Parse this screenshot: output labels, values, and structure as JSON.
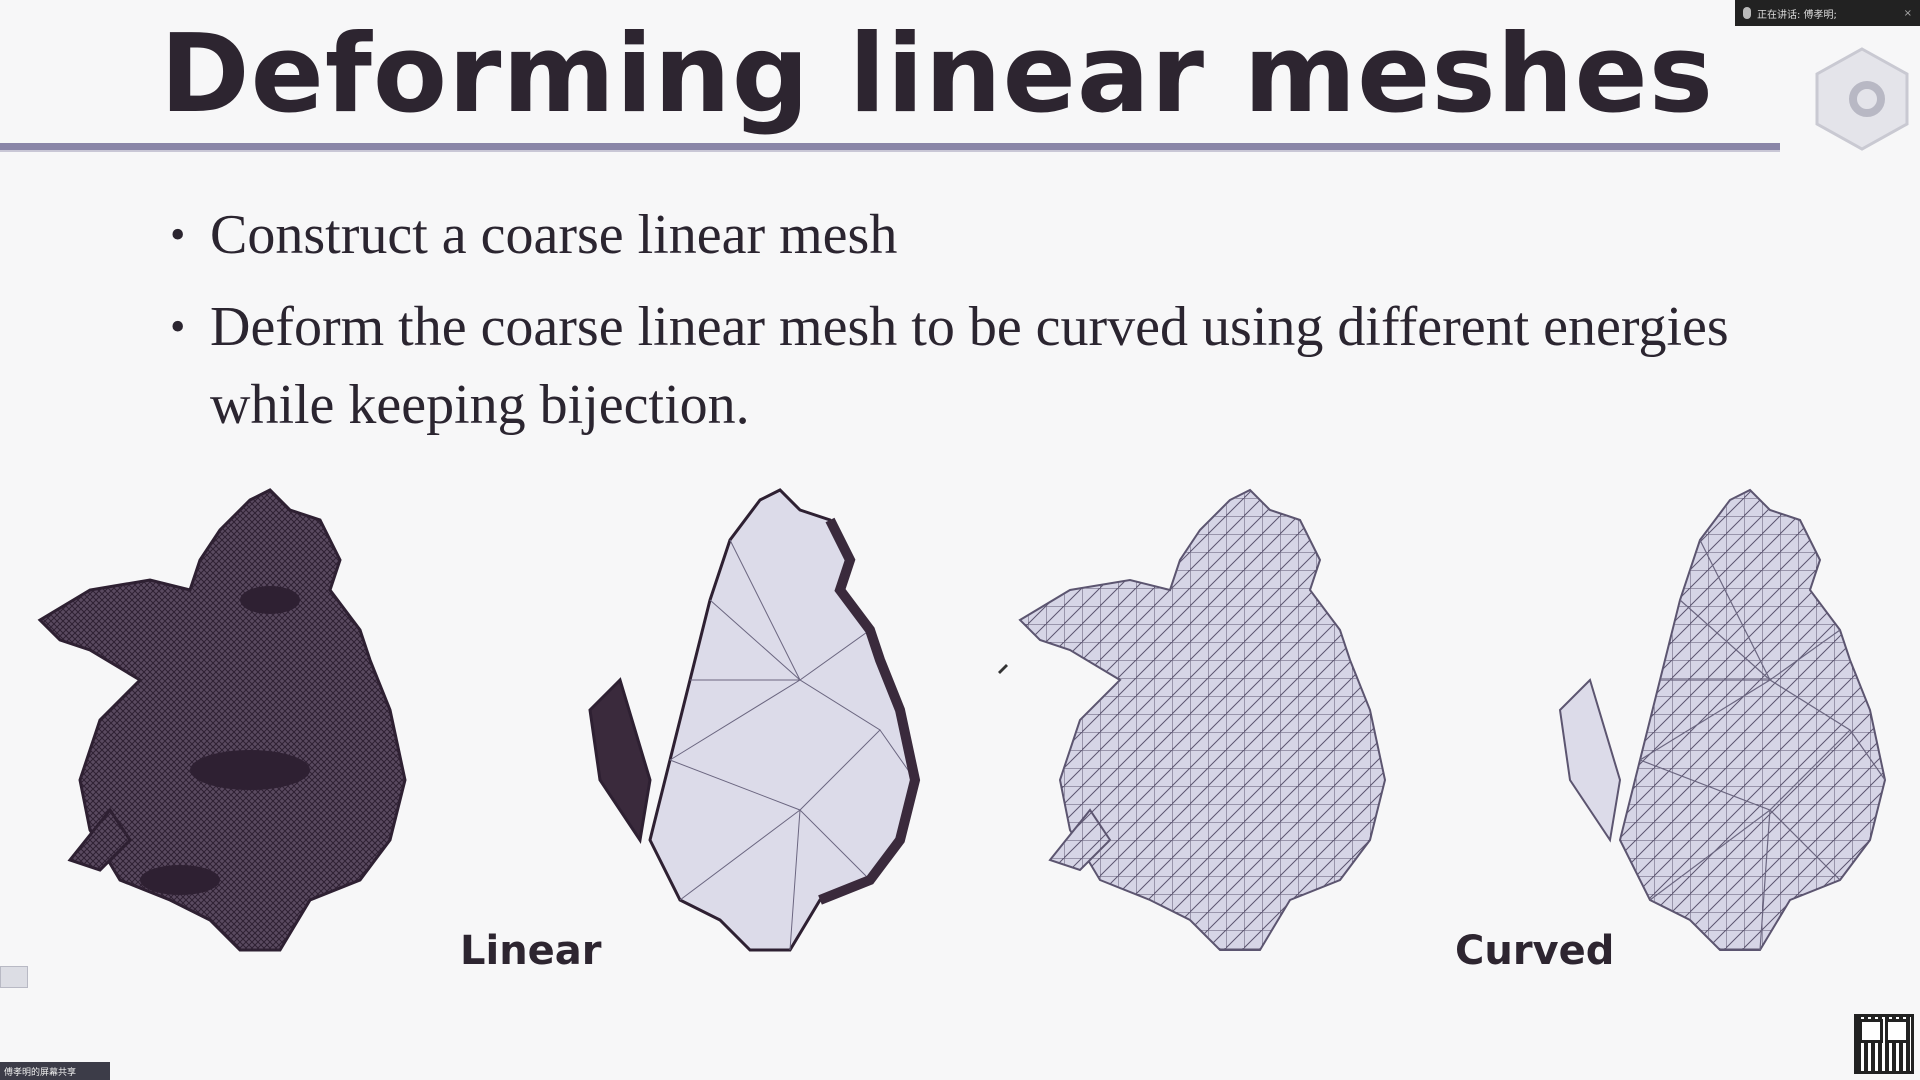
{
  "slide": {
    "title": "Deforming linear meshes",
    "bullets": [
      "Construct a coarse linear mesh",
      "Deform the coarse linear mesh to be curved using different energies while keeping bijection."
    ],
    "bullet_symbol": "•",
    "captions": {
      "linear": "Linear",
      "curved": "Curved"
    }
  },
  "overlay": {
    "status_text": "正在讲话: 傅孝明;",
    "close_symbol": "×",
    "share_label": "傅孝明的屏幕共享"
  },
  "colors": {
    "mesh_dark": "#3a2a3c",
    "mesh_light": "#d9d8ea",
    "title_rule": "#8a86a8"
  },
  "icons": [
    "mic-icon",
    "close-icon",
    "logo-icon",
    "qr-code-icon",
    "pen-cursor-icon"
  ]
}
